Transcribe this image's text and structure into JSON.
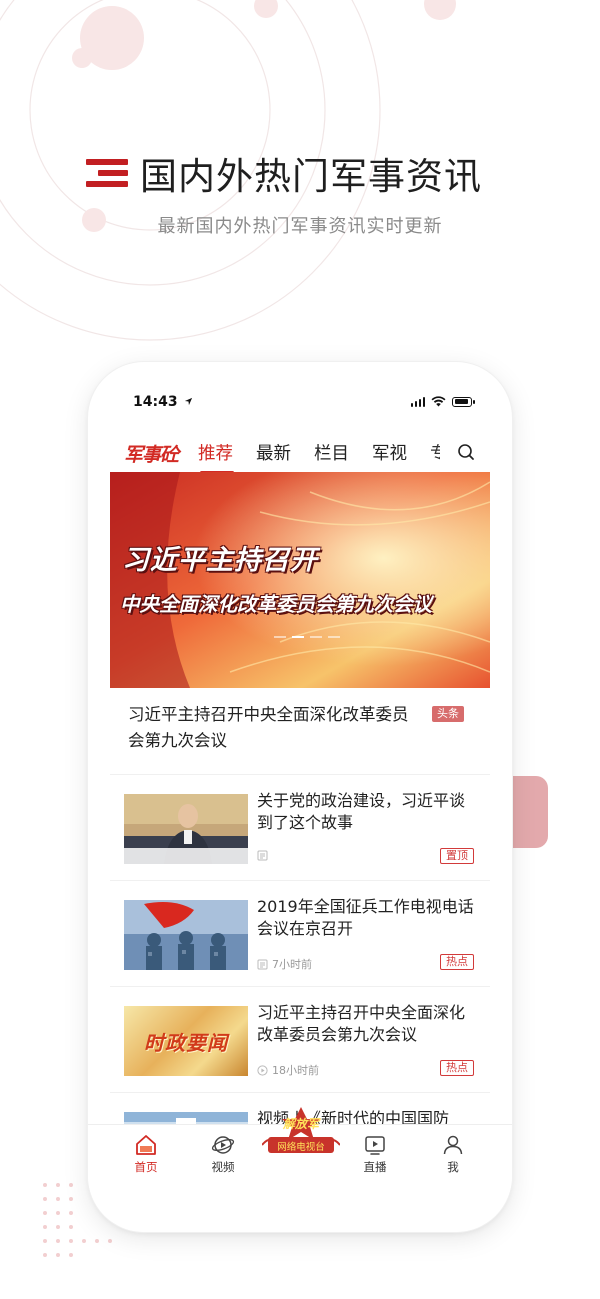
{
  "promo": {
    "title": "国内外热门军事资讯",
    "subtitle": "最新国内外热门军事资讯实时更新"
  },
  "status_bar": {
    "time": "14:43"
  },
  "nav": {
    "logo": "军事砼",
    "tabs": [
      "推荐",
      "最新",
      "栏目",
      "军视",
      "专"
    ],
    "active_tab": "推荐"
  },
  "banner": {
    "line1": "习近平主持召开",
    "line2": "中央全面深化改革委员会第九次会议",
    "active_dot": 1,
    "dot_count": 4
  },
  "headline": {
    "title": "习近平主持召开中央全面深化改革委员会第九次会议",
    "badge": "头条"
  },
  "news": [
    {
      "title": "关于党的政治建设，习近平谈到了这个故事",
      "time": "",
      "meta_icon": "article-icon",
      "badge": "置顶"
    },
    {
      "title": "2019年全国征兵工作电视电话会议在京召开",
      "time": "7小时前",
      "meta_icon": "article-icon",
      "badge": "热点"
    },
    {
      "title": "习近平主持召开中央全面深化改革委员会第九次会议",
      "time": "18小时前",
      "meta_icon": "play-icon",
      "badge": "热点",
      "thumb_text": "时政要闻"
    },
    {
      "title": "视频丨《新时代的中国国防",
      "time": "",
      "meta_icon": "",
      "badge": ""
    }
  ],
  "bottom_nav": {
    "items": [
      {
        "label": "首页",
        "icon": "home-icon"
      },
      {
        "label": "视频",
        "icon": "video-planet-icon"
      },
      {
        "label": "解放军网络电视台",
        "icon": "pla-tv-logo"
      },
      {
        "label": "直播",
        "icon": "live-tv-icon"
      },
      {
        "label": "我",
        "icon": "person-icon"
      }
    ],
    "center_logo_line1": "解放军",
    "center_logo_line2": "网络电视台",
    "active": "首页"
  },
  "colors": {
    "accent": "#d22a24",
    "badge_solid": "#d76c6c",
    "float_square": "#e3a9ac"
  }
}
